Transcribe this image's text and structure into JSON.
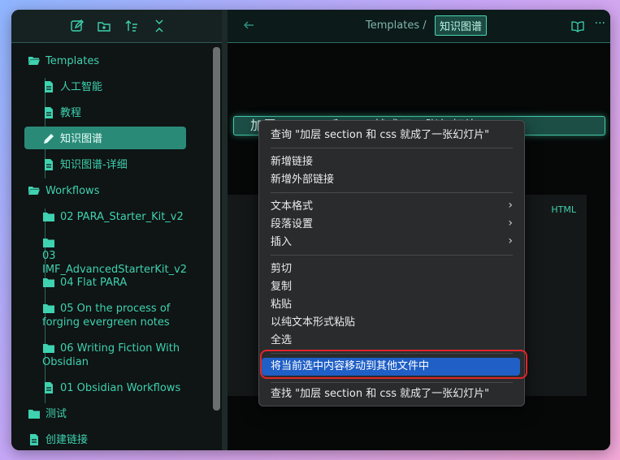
{
  "sidebar": {
    "toolbar_icons": [
      "edit-note-icon",
      "new-folder-icon",
      "sort-icon",
      "collapse-icon"
    ],
    "tree": [
      {
        "label": "Templates",
        "type": "folder-open"
      },
      {
        "label": "人工智能",
        "type": "file"
      },
      {
        "label": "教程",
        "type": "file"
      },
      {
        "label": "知识图谱",
        "type": "file-edit",
        "active": true
      },
      {
        "label": "知识图谱-详细",
        "type": "file"
      },
      {
        "label": "Workflows",
        "type": "folder-open"
      },
      {
        "label": "02 PARA_Starter_Kit_v2",
        "type": "folder"
      },
      {
        "label": "03 IMF_AdvancedStarterKit_v2",
        "type": "folder"
      },
      {
        "label": "04 Flat PARA",
        "type": "folder"
      },
      {
        "label": "05 On the process of forging evergreen notes",
        "type": "folder"
      },
      {
        "label": "06 Writing Fiction With Obsidian",
        "type": "folder"
      },
      {
        "label": "01 Obsidian Workflows",
        "type": "file"
      },
      {
        "label": "测试",
        "type": "folder"
      },
      {
        "label": "创建链接",
        "type": "file"
      }
    ]
  },
  "header": {
    "breadcrumb_parent": "Templates /",
    "breadcrumb_current": "知识图谱"
  },
  "editor": {
    "title_fragment": "加层 section 和 css 就成了一张幻灯片",
    "code_lang": "HTML"
  },
  "context_menu": {
    "search": "查询 \"加层 section 和 css 就成了一张幻灯片\"",
    "new_link": "新增链接",
    "new_external_link": "新增外部链接",
    "text_format": "文本格式",
    "paragraph_settings": "段落设置",
    "insert": "插入",
    "cut": "剪切",
    "copy": "复制",
    "paste": "粘贴",
    "paste_plain": "以纯文本形式粘贴",
    "select_all": "全选",
    "move_selection": "将当前选中内容移动到其他文件中",
    "find": "查找 \"加层 section 和 css 就成了一张幻灯片\""
  },
  "colors": {
    "accent": "#3ed2b0",
    "active_row": "#2a8a78",
    "menu_highlight": "#1f5fc6",
    "callout_outline": "#e0262b"
  }
}
